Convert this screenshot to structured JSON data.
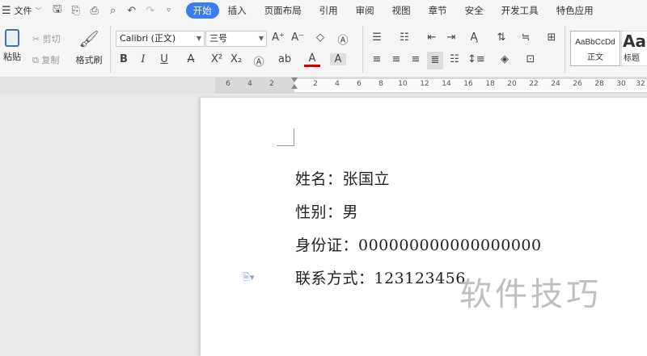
{
  "menu": {
    "label": "文件"
  },
  "tabs": [
    "开始",
    "插入",
    "页面布局",
    "引用",
    "审阅",
    "视图",
    "章节",
    "安全",
    "开发工具",
    "特色应用"
  ],
  "ribbon": {
    "paste_label": "粘贴",
    "cut_label": "剪切",
    "copy_label": "复制",
    "format_painter_label": "格式刷",
    "font_name": "Calibri (正文)",
    "font_size": "三号",
    "style_normal_preview": "AaBbCcDd",
    "style_normal_label": "正文",
    "style_heading_preview": "Aa",
    "style_heading_label": "标题"
  },
  "ruler": {
    "ticks": [
      "6",
      "4",
      "2",
      "2",
      "4",
      "6",
      "8",
      "10",
      "12",
      "14",
      "16",
      "18",
      "20",
      "22",
      "24",
      "26",
      "28",
      "30",
      "32"
    ]
  },
  "document": {
    "lines": [
      "姓名：张国立",
      "性别：男",
      "身份证：000000000000000000",
      "联系方式：123123456"
    ]
  },
  "watermark": "软件技巧",
  "colors": {
    "accent": "#3b7cf0",
    "page": "#ffffff",
    "workspace": "#e9e9e9"
  }
}
